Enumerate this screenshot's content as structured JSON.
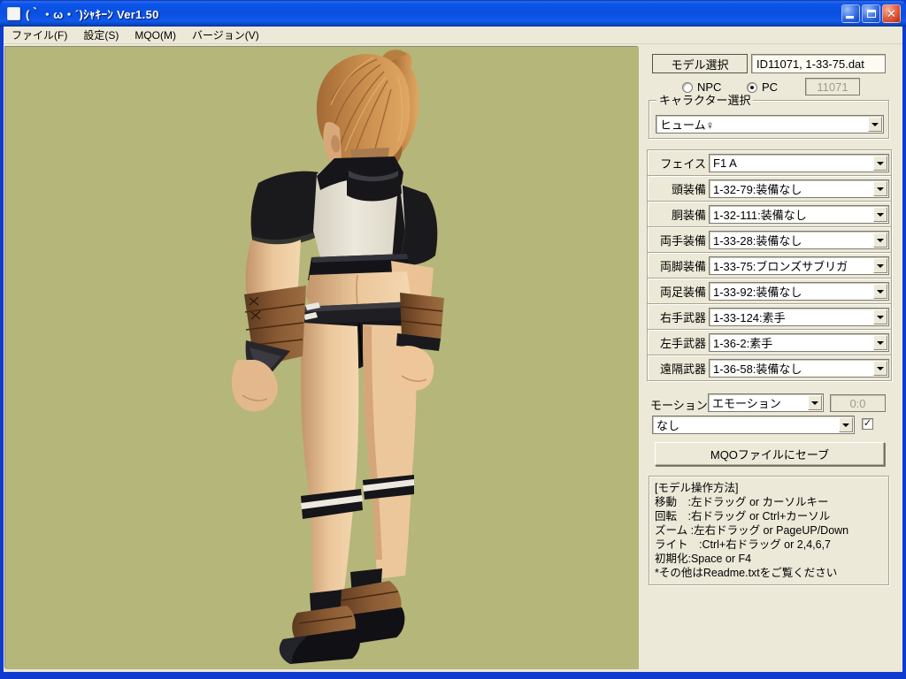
{
  "window": {
    "title": "(｀・ω・´)ｼｬｷｰﾝ Ver1.50"
  },
  "menu": {
    "items": [
      "ファイル(F)",
      "設定(S)",
      "MQO(M)",
      "バージョン(V)"
    ]
  },
  "panel": {
    "model_select_button": "モデル選択",
    "model_file": "ID11071, 1-33-75.dat",
    "radio_npc_label": "NPC",
    "radio_pc_label": "PC",
    "id_value": "11071",
    "char_group_label": "キャラクター選択",
    "char_value": "ヒューム♀",
    "equip_rows": [
      {
        "label": "フェイス",
        "value": "F1 A"
      },
      {
        "label": "頭装備",
        "value": "1-32-79:装備なし"
      },
      {
        "label": "胴装備",
        "value": "1-32-111:装備なし"
      },
      {
        "label": "両手装備",
        "value": "1-33-28:装備なし"
      },
      {
        "label": "両脚装備",
        "value": "1-33-75:ブロンズサブリガ"
      },
      {
        "label": "両足装備",
        "value": "1-33-92:装備なし"
      },
      {
        "label": "右手武器",
        "value": "1-33-124:素手"
      },
      {
        "label": "左手武器",
        "value": "1-36-2:素手"
      },
      {
        "label": "遠隔武器",
        "value": "1-36-58:装備なし"
      }
    ],
    "motion_label": "モーション",
    "motion_value": "エモーション",
    "motion_frame": "0:0",
    "anim_value": "なし",
    "anim_checkbox_checked": "✓",
    "save_button": "MQOファイルにセーブ",
    "help_lines": [
      "[モデル操作方法]",
      "移動　:左ドラッグ or カーソルキー",
      "回転　:右ドラッグ or Ctrl+カーソル",
      "ズーム :左右ドラッグ or PageUP/Down",
      "ライト　:Ctrl+右ドラッグ or 2,4,6,7",
      "初期化:Space or F4",
      "*その他はReadme.txtをご覧ください"
    ]
  },
  "colors": {
    "viewport_bg": "#b5b679",
    "panel_bg": "#ece9d8",
    "titlebar_blue": "#0a50e0",
    "close_red": "#d6492b"
  }
}
